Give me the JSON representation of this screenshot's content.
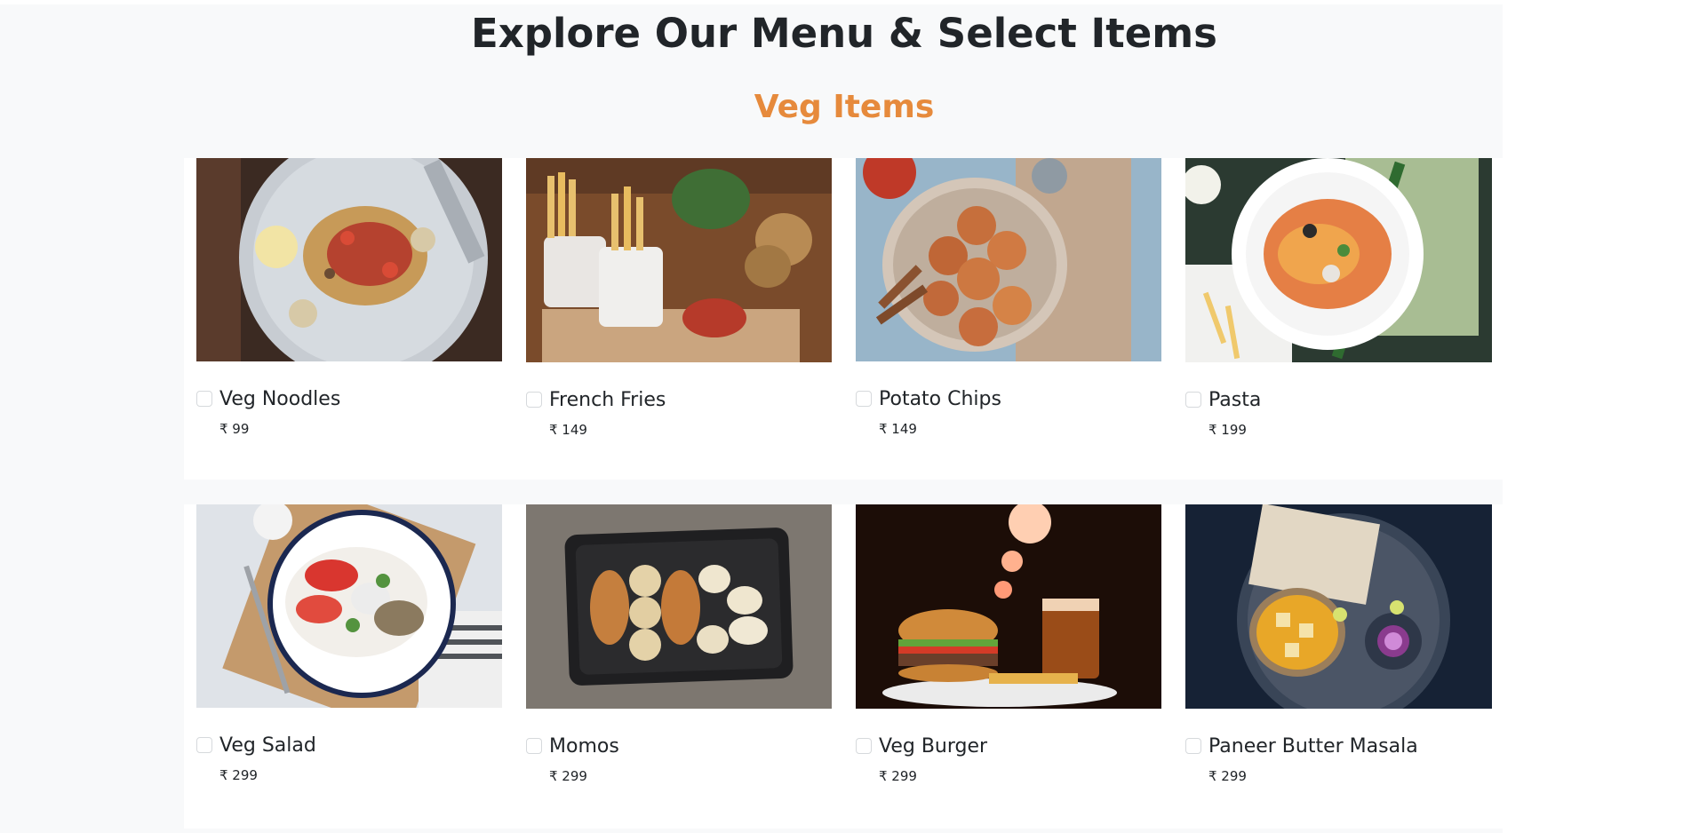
{
  "page": {
    "title": "Explore Our Menu & Select Items",
    "section_title": "Veg Items"
  },
  "colors": {
    "section_title": "#e68a3c",
    "background": "#f8f9fa",
    "card": "#ffffff"
  },
  "rows": [
    [
      {
        "name": "Veg Noodles",
        "price": "₹ 99",
        "image": "veg-noodles-photo"
      },
      {
        "name": "French Fries",
        "price": "₹ 149",
        "image": "french-fries-photo"
      },
      {
        "name": "Potato Chips",
        "price": "₹ 149",
        "image": "potato-chips-photo"
      },
      {
        "name": "Pasta",
        "price": "₹ 199",
        "image": "pasta-photo"
      }
    ],
    [
      {
        "name": "Veg Salad",
        "price": "₹ 299",
        "image": "veg-salad-photo"
      },
      {
        "name": "Momos",
        "price": "₹ 299",
        "image": "momos-photo"
      },
      {
        "name": "Veg Burger",
        "price": "₹ 299",
        "image": "veg-burger-photo"
      },
      {
        "name": "Paneer Butter Masala",
        "price": "₹ 299",
        "image": "paneer-butter-masala-photo"
      }
    ]
  ]
}
